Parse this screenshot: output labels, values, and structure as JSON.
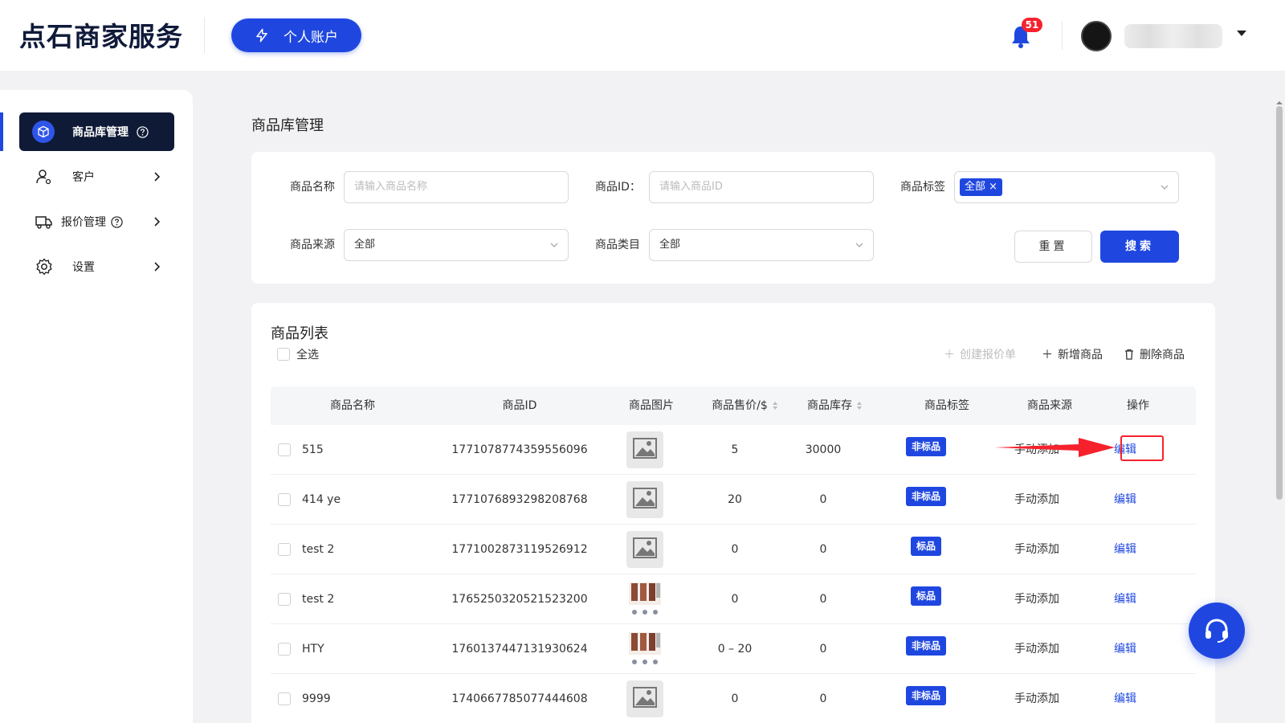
{
  "header": {
    "logo": "点石商家服务",
    "account_button": "个人账户",
    "notification_count": "51",
    "user_name_blurred": ""
  },
  "sidebar": {
    "items": [
      {
        "label": "商品库管理",
        "active": true,
        "icon": "box-icon"
      },
      {
        "label": "客户",
        "icon": "user-icon"
      },
      {
        "label": "报价管理",
        "icon": "truck-icon"
      },
      {
        "label": "设置",
        "icon": "gear-icon"
      }
    ]
  },
  "page": {
    "title": "商品库管理"
  },
  "filters": {
    "name_label": "商品名称",
    "name_placeholder": "请输入商品名称",
    "id_label": "商品ID：",
    "id_placeholder": "请输入商品ID",
    "tag_label": "商品标签",
    "tag_value": "全部",
    "source_label": "商品来源",
    "source_value": "全部",
    "category_label": "商品类目",
    "category_value": "全部",
    "reset_label": "重置",
    "search_label": "搜索"
  },
  "list": {
    "title": "商品列表",
    "select_all": "全选",
    "create_quote": "创建报价单",
    "add_product": "新增商品",
    "delete_product": "删除商品",
    "columns": [
      "商品名称",
      "商品ID",
      "商品图片",
      "商品售价/$",
      "商品库存",
      "商品标签",
      "商品来源",
      "操作"
    ],
    "rows": [
      {
        "name": "515",
        "id": "1771078774359556096",
        "image": "placeholder",
        "price": "5",
        "stock": "30000",
        "tag": "非标品",
        "source": "手动添加",
        "action": "编辑"
      },
      {
        "name": "414 ye",
        "id": "1771076893298208768",
        "image": "placeholder",
        "price": "20",
        "stock": "0",
        "tag": "非标品",
        "source": "手动添加",
        "action": "编辑"
      },
      {
        "name": "test 2",
        "id": "1771002873119526912",
        "image": "placeholder",
        "price": "0",
        "stock": "0",
        "tag": "标品",
        "source": "手动添加",
        "action": "编辑"
      },
      {
        "name": "test 2",
        "id": "1765250320521523200",
        "image": "photo",
        "price": "0",
        "stock": "0",
        "tag": "标品",
        "source": "手动添加",
        "action": "编辑"
      },
      {
        "name": "HTY",
        "id": "1760137447131930624",
        "image": "photo",
        "price": "0 – 20",
        "stock": "0",
        "tag": "非标品",
        "source": "手动添加",
        "action": "编辑"
      },
      {
        "name": "9999",
        "id": "1740667785077444608",
        "image": "placeholder",
        "price": "0",
        "stock": "0",
        "tag": "非标品",
        "source": "手动添加",
        "action": "编辑"
      }
    ]
  },
  "colors": {
    "accent": "#1f47e0",
    "nav_dark": "#0f1a36",
    "alert": "#f5222d"
  }
}
